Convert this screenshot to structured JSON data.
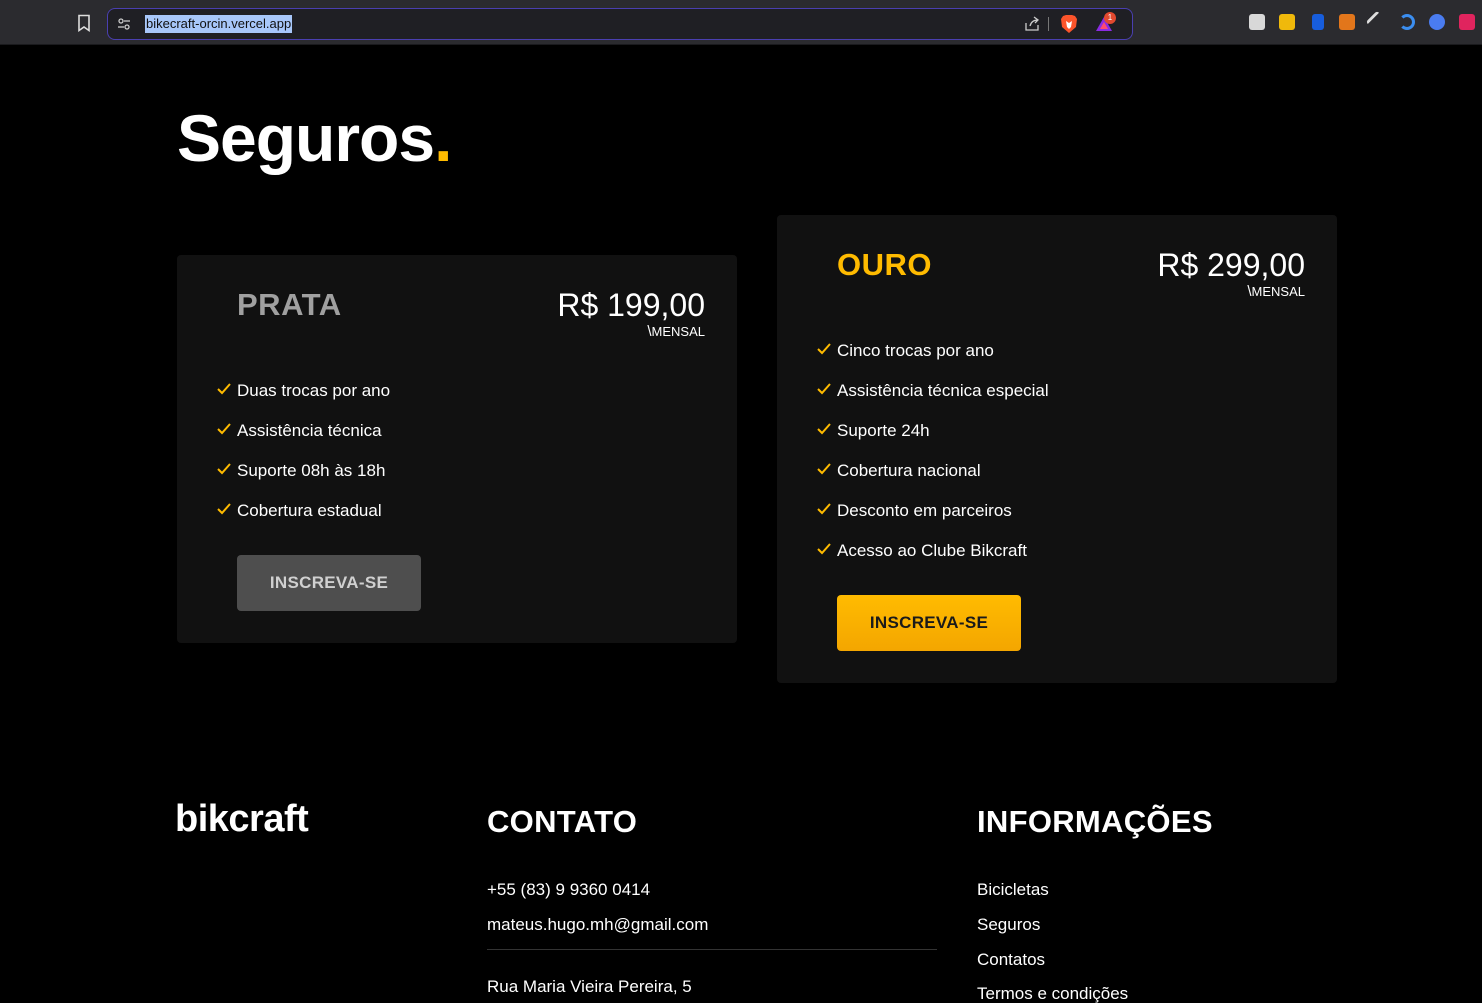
{
  "browser": {
    "url": "bikecraft-orcin.vercel.app",
    "notification_count": "1",
    "icons": [
      "bookmark-icon",
      "site-info-icon",
      "share-icon",
      "brave-shield-icon",
      "brave-rewards-icon",
      "extension-icons"
    ]
  },
  "page": {
    "title": "Seguros",
    "title_dot": ".",
    "accent_color": "#ffbb00"
  },
  "plans": {
    "prata": {
      "name": "PRATA",
      "price": "R$ 199,00",
      "period": "MENSAL",
      "features": [
        "Duas trocas por ano",
        "Assistência técnica",
        "Suporte 08h às 18h",
        "Cobertura estadual"
      ],
      "button": "INSCREVA-SE"
    },
    "ouro": {
      "name": "OURO",
      "price": "R$ 299,00",
      "period": "MENSAL",
      "features": [
        "Cinco trocas por ano",
        "Assistência técnica especial",
        "Suporte 24h",
        "Cobertura nacional",
        "Desconto em parceiros",
        "Acesso ao Clube Bikcraft"
      ],
      "button": "INSCREVA-SE"
    }
  },
  "footer": {
    "logo": "bikcraft",
    "contato": {
      "title": "CONTATO",
      "phone": "+55 (83) 9 9360 0414",
      "email": "mateus.hugo.mh@gmail.com",
      "address": "Rua Maria Vieira Pereira, 5"
    },
    "informacoes": {
      "title": "INFORMAÇÕES",
      "links": [
        "Bicicletas",
        "Seguros",
        "Contatos",
        "Termos e condições"
      ]
    }
  }
}
